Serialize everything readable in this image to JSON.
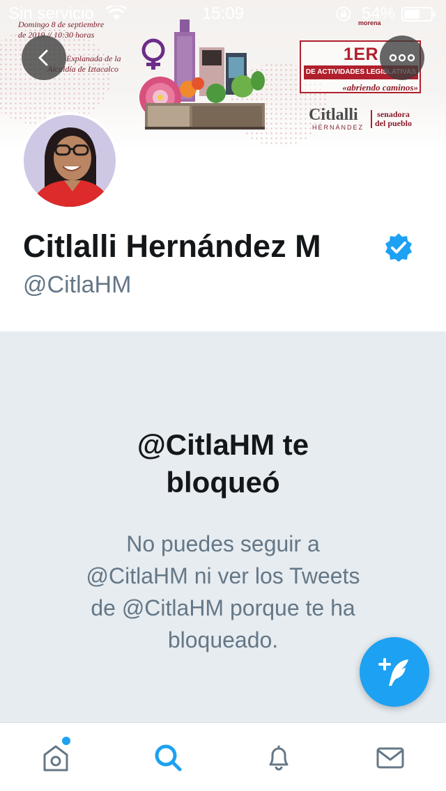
{
  "status_bar": {
    "carrier": "Sin servicio",
    "time": "15:09",
    "battery_percent": "54%"
  },
  "banner": {
    "event_date": "Domingo 8 de septiembre",
    "event_year_time": "de 2019 // 10:30 horas",
    "event_place_1": "Explanada de la",
    "event_place_2": "Alcaldía de Iztacalco",
    "report_title": "1ER INFORME",
    "report_subtitle": "DE ACTIVIDADES LEGISLATIVAS",
    "report_tagline": "«abriendo caminos»",
    "signature_name": "Citlalli",
    "signature_surname": "HERNÁNDEZ",
    "signature_tag_1": "senadora",
    "signature_tag_2": "del pueblo",
    "party": "morena"
  },
  "profile": {
    "name": "Citlalli Hernández M",
    "handle": "@CitlaHM",
    "verified": true
  },
  "blocked": {
    "title_line_1": "@CitlaHM te",
    "title_line_2": "bloqueó",
    "body_line_1": "No puedes seguir a",
    "body_line_2": "@CitlaHM ni ver los Tweets",
    "body_line_3": "de @CitlaHM porque te ha",
    "body_line_4": "bloqueado."
  },
  "tabs": [
    {
      "icon": "home-icon",
      "active": false,
      "has_notification_dot": true
    },
    {
      "icon": "search-icon",
      "active": true
    },
    {
      "icon": "bell-icon",
      "active": false
    },
    {
      "icon": "mail-icon",
      "active": false
    }
  ],
  "colors": {
    "accent": "#1da1f2",
    "banner_red": "#b0202c",
    "blocked_bg": "#e6ecf0",
    "secondary_text": "#657786"
  }
}
